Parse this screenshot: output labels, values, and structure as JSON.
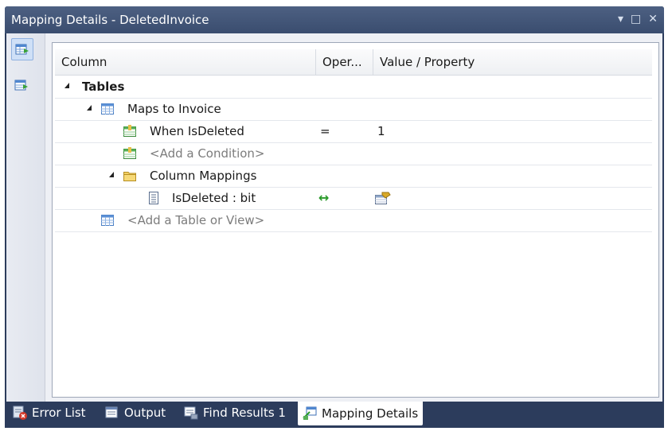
{
  "window": {
    "title": "Mapping Details - DeletedInvoice",
    "controls": [
      "▾",
      "□",
      "✕"
    ]
  },
  "side_toolbar": [
    {
      "icon": "map-entity-to-tables-icon",
      "active": true
    },
    {
      "icon": "map-entity-to-functions-icon",
      "active": false
    }
  ],
  "grid": {
    "columns": [
      "Column",
      "Oper...",
      "Value / Property"
    ],
    "rows": {
      "tables": {
        "label": "Tables"
      },
      "maps_to": {
        "label": "Maps to Invoice"
      },
      "condition": {
        "label": "When IsDeleted",
        "operator": "=",
        "value": "1"
      },
      "add_condition": {
        "label": "<Add a Condition>"
      },
      "column_mappings": {
        "label": "Column Mappings"
      },
      "mapping": {
        "label": "IsDeleted : bit",
        "operator": "↔"
      },
      "add_table": {
        "label": "<Add a Table or View>"
      }
    }
  },
  "tabs": [
    {
      "label": "Error List",
      "icon": "error-list-icon"
    },
    {
      "label": "Output",
      "icon": "output-icon"
    },
    {
      "label": "Find Results 1",
      "icon": "find-results-icon"
    },
    {
      "label": "Mapping Details",
      "icon": "mapping-details-icon",
      "active": true
    }
  ],
  "colors": {
    "frame": "#2c3c5c",
    "titlebar": "#3a4d6f",
    "operator_arrow": "#2a9a2a",
    "folder": "#e8c04a"
  }
}
